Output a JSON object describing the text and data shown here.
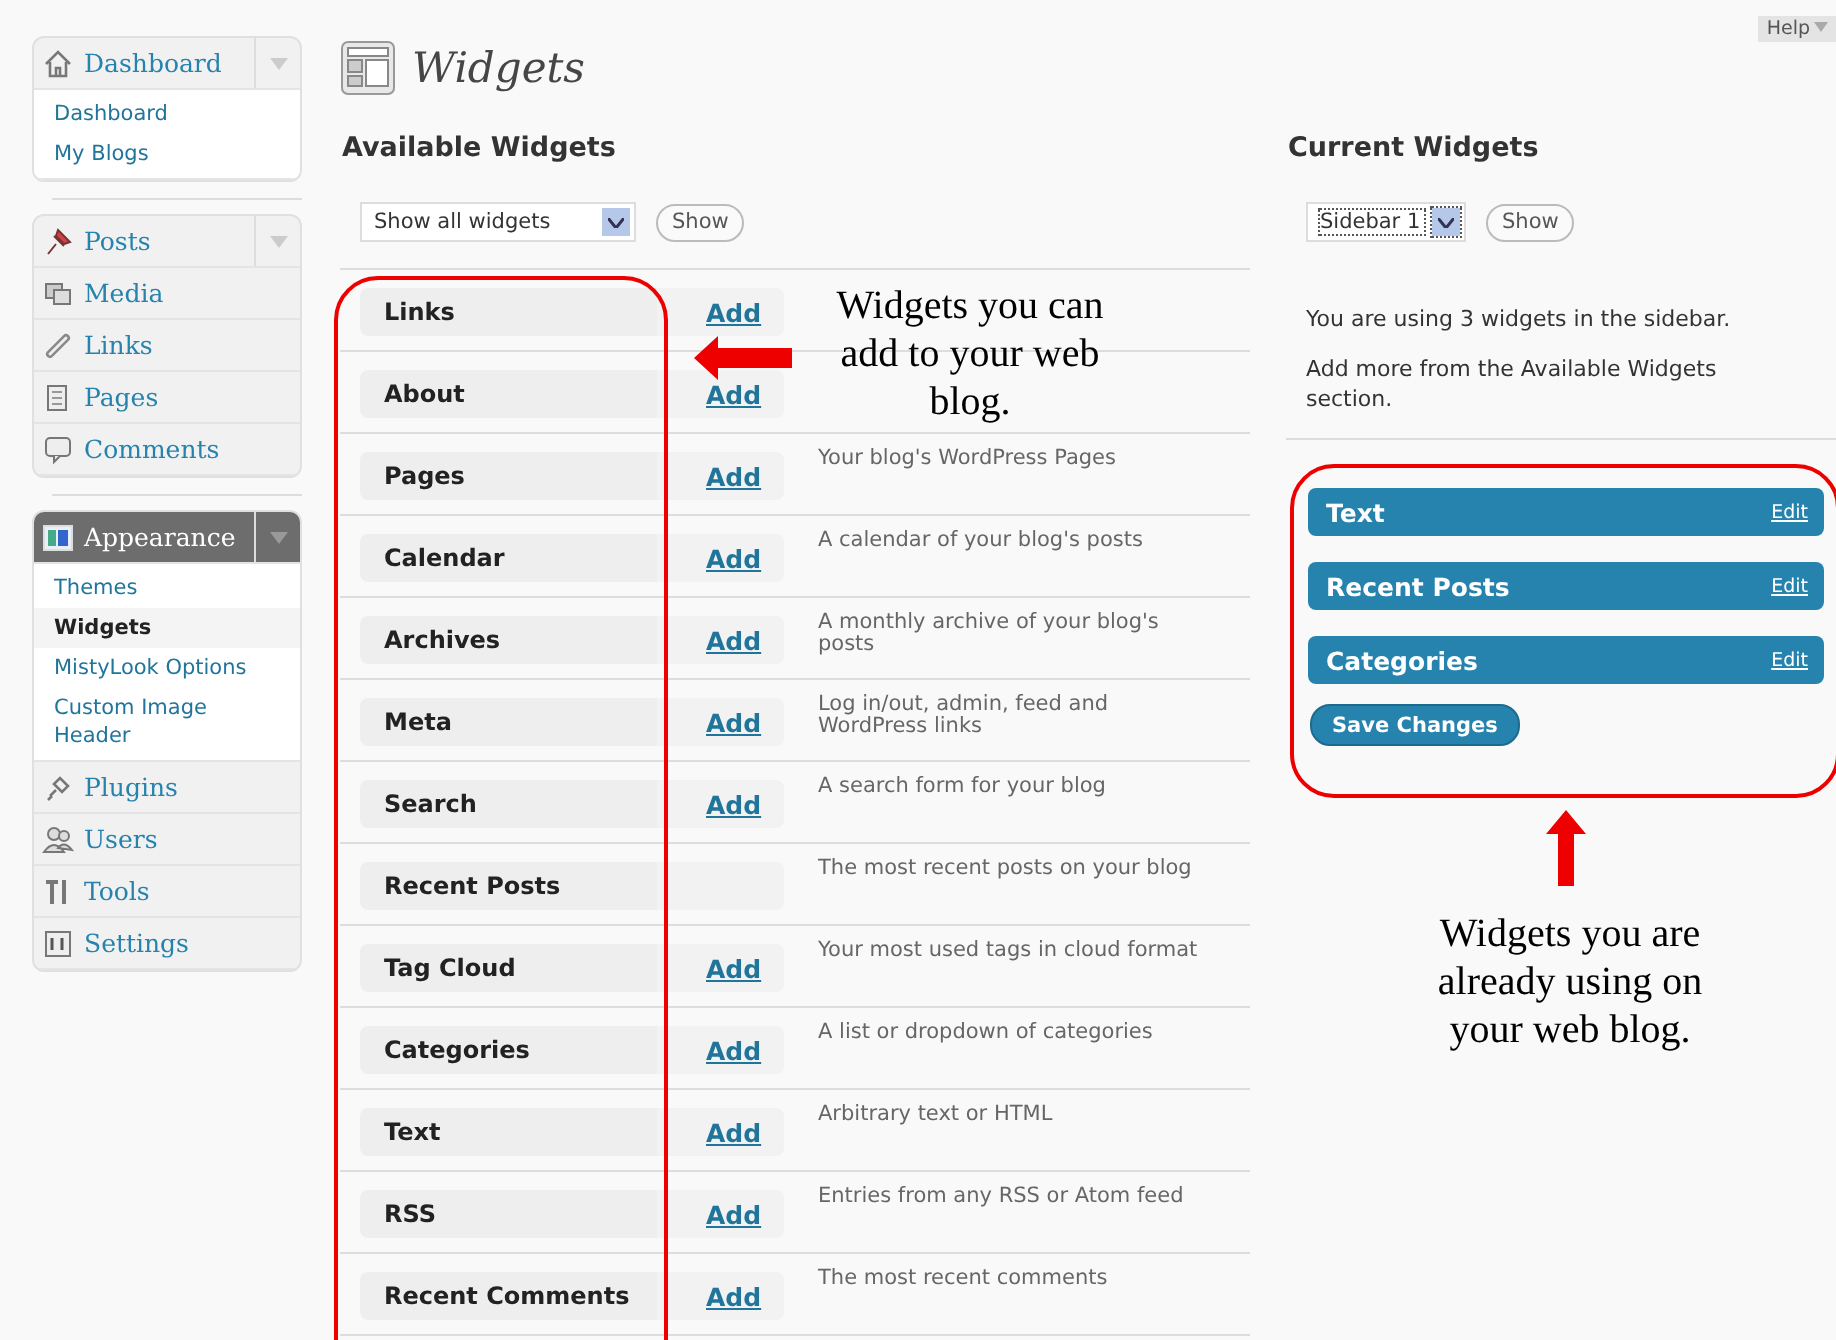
{
  "help": {
    "label": "Help"
  },
  "sidebar": {
    "sections": [
      [
        {
          "label": "Dashboard",
          "current": false,
          "expandable": true,
          "children": [
            {
              "label": "Dashboard",
              "selected": false
            },
            {
              "label": "My Blogs",
              "selected": false
            }
          ]
        }
      ],
      [
        {
          "label": "Posts",
          "current": false,
          "expandable": true
        },
        {
          "label": "Media",
          "current": false,
          "expandable": false
        },
        {
          "label": "Links",
          "current": false,
          "expandable": false
        },
        {
          "label": "Pages",
          "current": false,
          "expandable": false
        },
        {
          "label": "Comments",
          "current": false,
          "expandable": false
        }
      ],
      [
        {
          "label": "Appearance",
          "current": true,
          "expandable": true,
          "children": [
            {
              "label": "Themes",
              "selected": false
            },
            {
              "label": "Widgets",
              "selected": true
            },
            {
              "label": "MistyLook Options",
              "selected": false
            },
            {
              "label": "Custom Image Header",
              "selected": false
            }
          ]
        },
        {
          "label": "Plugins",
          "current": false,
          "expandable": false
        },
        {
          "label": "Users",
          "current": false,
          "expandable": false
        },
        {
          "label": "Tools",
          "current": false,
          "expandable": false
        },
        {
          "label": "Settings",
          "current": false,
          "expandable": false
        }
      ]
    ]
  },
  "page": {
    "title": "Widgets"
  },
  "available": {
    "heading": "Available Widgets",
    "filter": {
      "value": "Show all widgets"
    },
    "show_button": "Show",
    "rows": [
      {
        "name": "Links",
        "action": "Add"
      },
      {
        "name": "About",
        "action": "Add"
      },
      {
        "name": "Pages",
        "action": "Add",
        "description": "Your blog's WordPress Pages"
      },
      {
        "name": "Calendar",
        "action": "Add",
        "description": "A calendar of your blog's posts"
      },
      {
        "name": "Archives",
        "action": "Add",
        "description": "A monthly archive of your blog's posts"
      },
      {
        "name": "Meta",
        "action": "Add",
        "description": "Log in/out, admin, feed and WordPress links"
      },
      {
        "name": "Search",
        "action": "Add",
        "description": "A search form for your blog"
      },
      {
        "name": "Recent Posts",
        "description": "The most recent posts on your blog"
      },
      {
        "name": "Tag Cloud",
        "action": "Add",
        "description": "Your most used tags in cloud format"
      },
      {
        "name": "Categories",
        "action": "Add",
        "description": "A list or dropdown of categories"
      },
      {
        "name": "Text",
        "action": "Add",
        "description": "Arbitrary text or HTML"
      },
      {
        "name": "RSS",
        "action": "Add",
        "description": "Entries from any RSS or Atom feed"
      },
      {
        "name": "Recent Comments",
        "action": "Add",
        "description": "The most recent comments"
      }
    ]
  },
  "current": {
    "heading": "Current Widgets",
    "sidebar_select": {
      "value": "Sidebar 1"
    },
    "show_button": "Show",
    "info": [
      "You are using 3 widgets in the sidebar.",
      "Add more from the Available Widgets section."
    ],
    "widgets": [
      {
        "name": "Text",
        "action": "Edit"
      },
      {
        "name": "Recent Posts",
        "action": "Edit"
      },
      {
        "name": "Categories",
        "action": "Edit"
      }
    ],
    "save_button": "Save Changes"
  },
  "annotations": [
    {
      "text": "Widgets you can add to your web blog."
    },
    {
      "text": "Widgets you are already using on your web blog."
    }
  ]
}
